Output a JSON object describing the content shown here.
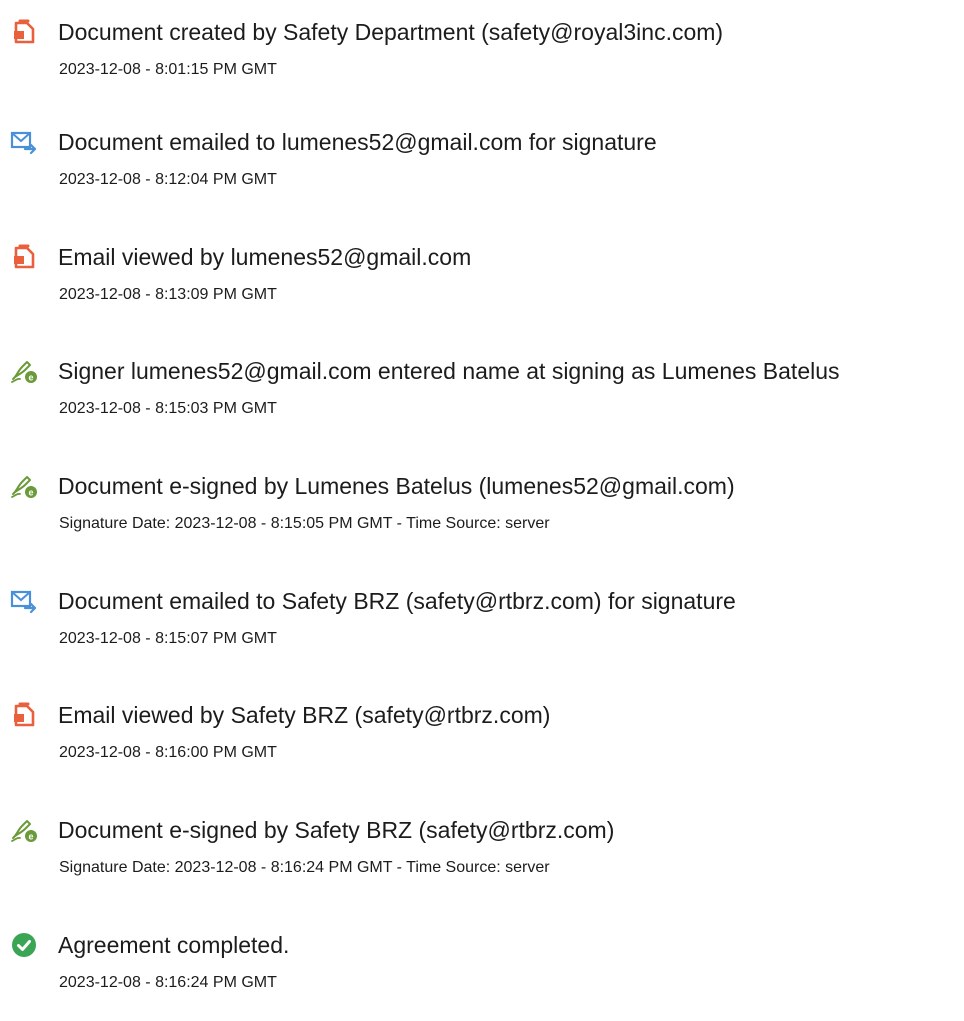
{
  "colors": {
    "doc_icon": "#e8603c",
    "email_icon": "#4a90d9",
    "sign_icon": "#6a9a3a",
    "complete_icon": "#3aa655"
  },
  "events": [
    {
      "icon": "document-icon",
      "title": "Document created by Safety Department (safety@royal3inc.com)",
      "subtitle": "2023-12-08 - 8:01:15 PM GMT"
    },
    {
      "icon": "email-send-icon",
      "title": "Document emailed to lumenes52@gmail.com for signature",
      "subtitle": "2023-12-08 - 8:12:04 PM GMT"
    },
    {
      "icon": "document-icon",
      "title": "Email viewed by lumenes52@gmail.com",
      "subtitle": "2023-12-08 - 8:13:09 PM GMT"
    },
    {
      "icon": "e-sign-icon",
      "title": "Signer lumenes52@gmail.com entered name at signing as Lumenes Batelus",
      "subtitle": "2023-12-08 - 8:15:03 PM GMT"
    },
    {
      "icon": "e-sign-icon",
      "title": "Document e-signed by Lumenes Batelus (lumenes52@gmail.com)",
      "subtitle": "Signature Date: 2023-12-08 - 8:15:05 PM GMT - Time Source: server"
    },
    {
      "icon": "email-send-icon",
      "title": "Document emailed to Safety BRZ (safety@rtbrz.com) for signature",
      "subtitle": "2023-12-08 - 8:15:07 PM GMT"
    },
    {
      "icon": "document-icon",
      "title": "Email viewed by Safety BRZ (safety@rtbrz.com)",
      "subtitle": "2023-12-08 - 8:16:00 PM GMT"
    },
    {
      "icon": "e-sign-icon",
      "title": "Document e-signed by Safety BRZ (safety@rtbrz.com)",
      "subtitle": "Signature Date: 2023-12-08 - 8:16:24 PM GMT - Time Source: server"
    },
    {
      "icon": "checkmark-circle-icon",
      "title": "Agreement completed.",
      "subtitle": "2023-12-08 - 8:16:24 PM GMT"
    }
  ]
}
